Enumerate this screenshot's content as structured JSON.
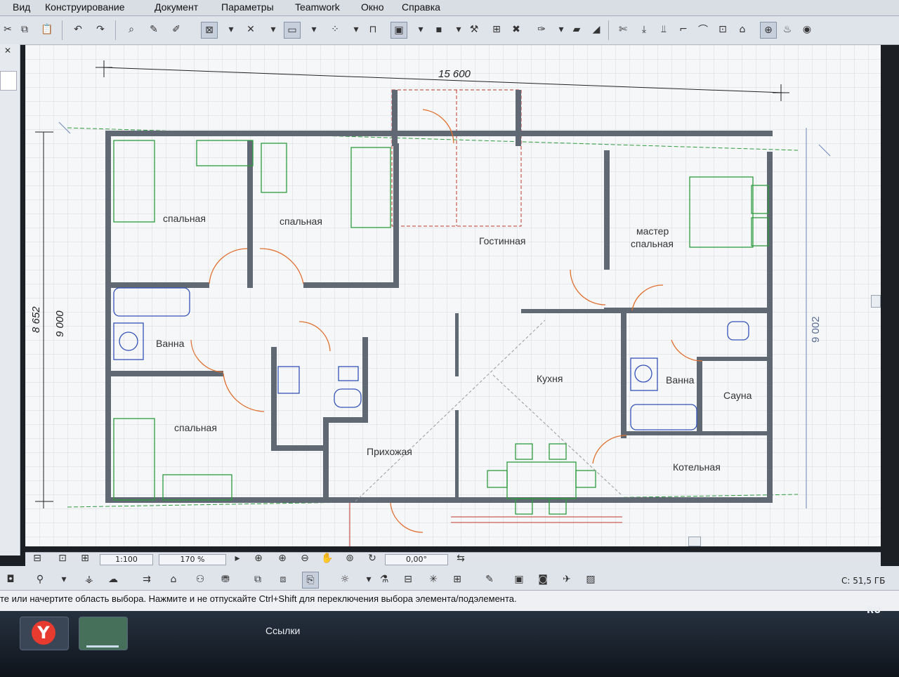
{
  "menu": [
    "Вид",
    "Конструирование",
    "Документ",
    "Параметры",
    "Teamwork",
    "Окно",
    "Справка"
  ],
  "rooms": {
    "bedroom1": "спальная",
    "bedroom2": "спальная",
    "bedroom3": "спальная",
    "master_line1": "мастер",
    "master_line2": "спальная",
    "living": "Гостинная",
    "bath1": "Ванна",
    "bath2": "Ванна",
    "kitchen": "Кухня",
    "sauna": "Сауна",
    "hall": "Прихожая",
    "boiler": "Котельная"
  },
  "dimensions": {
    "top": "15 600",
    "left_outer": "8 652",
    "left_inner": "9 000",
    "right": "9 002"
  },
  "statusbar": {
    "scale": "1:100",
    "zoom": "170 %",
    "angle": "0,00°"
  },
  "hint_text": "те или начертите область выбора. Нажмите и не отпускайте Ctrl+Shift для переключения выбора элемента/подэлемента.",
  "disk_info": "C: 51,5 ГБ",
  "language": "RU",
  "taskbar": {
    "links": "Ссылки"
  },
  "colors": {
    "wall": "#5f6873",
    "furniture": "#2f9b3e",
    "door": "#e07030",
    "fixture": "#3352b8",
    "accent": "#c0392b"
  }
}
